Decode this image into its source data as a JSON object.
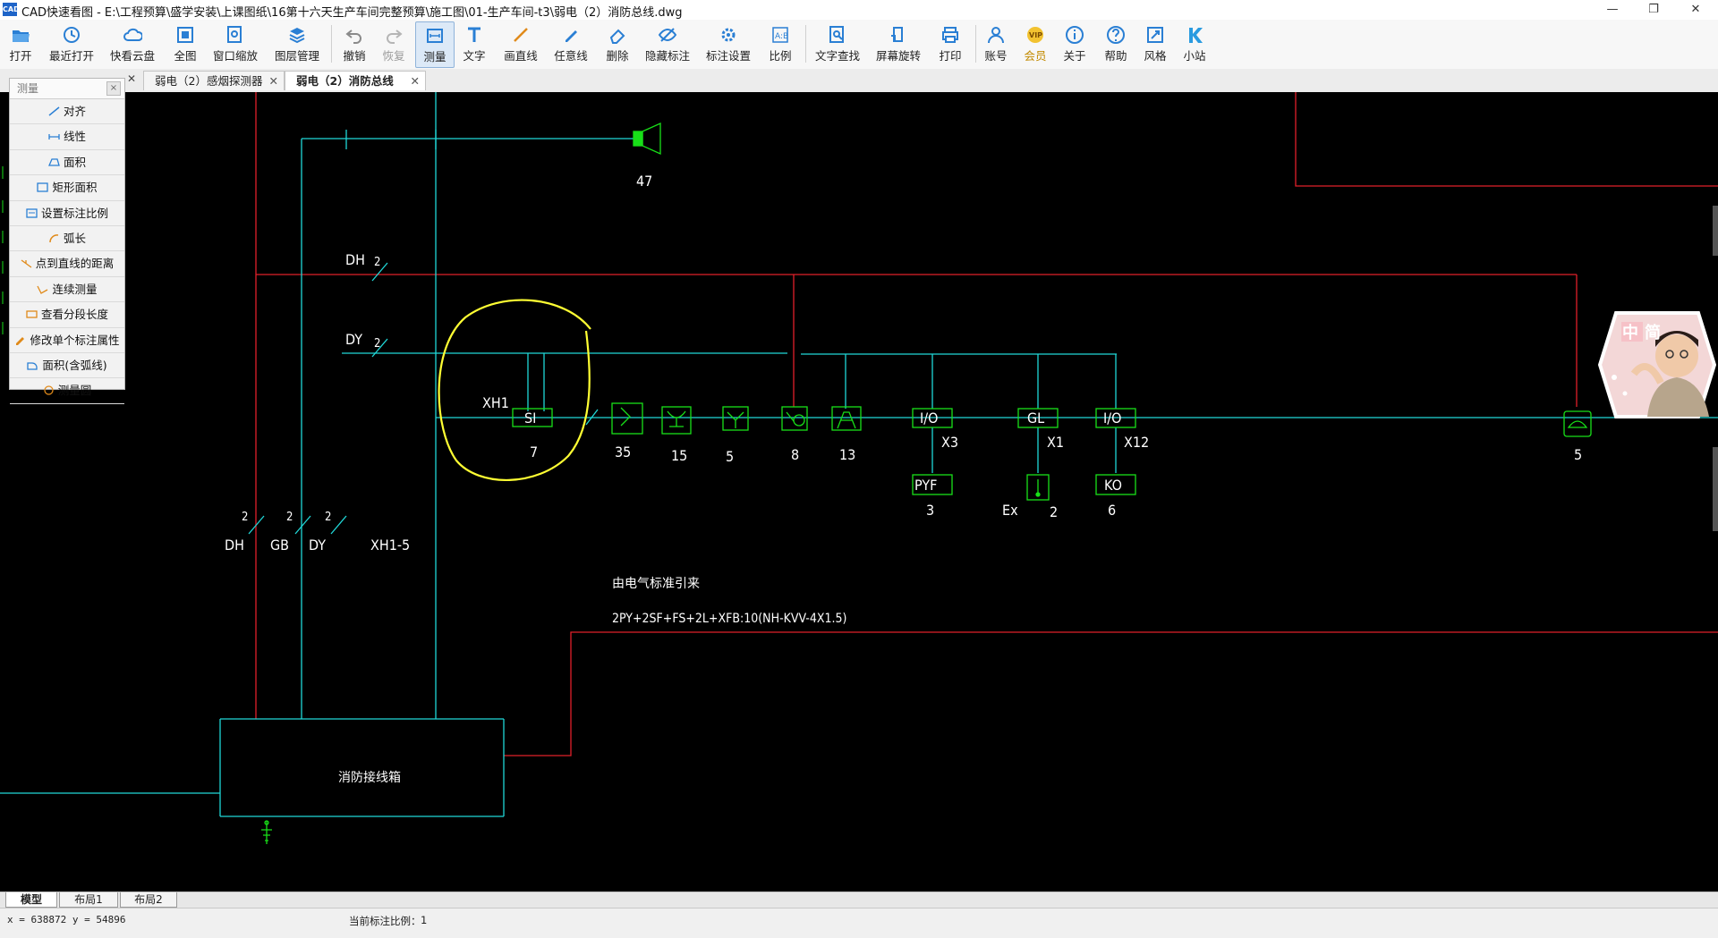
{
  "window": {
    "title": "CAD快速看图 - E:\\工程预算\\盛学安装\\上课图纸\\16第十六天生产车间完整预算\\施工图\\01-生产车间-t3\\弱电（2）消防总线.dwg",
    "app_icon": "CAD",
    "controls": {
      "minimize": "—",
      "maximize": "❐",
      "close": "✕"
    }
  },
  "toolbar": {
    "buttons": [
      {
        "label": "打开",
        "icon": "folder-open-icon"
      },
      {
        "label": "最近打开",
        "icon": "history-icon"
      },
      {
        "label": "快看云盘",
        "icon": "cloud-icon"
      },
      {
        "label": "全图",
        "icon": "fullview-icon"
      },
      {
        "label": "窗口缩放",
        "icon": "window-zoom-icon"
      },
      {
        "label": "图层管理",
        "icon": "layers-icon"
      },
      {
        "label": "撤销",
        "icon": "undo-icon"
      },
      {
        "label": "恢复",
        "icon": "redo-icon"
      },
      {
        "label": "测量",
        "icon": "measure-icon"
      },
      {
        "label": "文字",
        "icon": "text-icon"
      },
      {
        "label": "画直线",
        "icon": "line-icon"
      },
      {
        "label": "任意线",
        "icon": "pen-icon"
      },
      {
        "label": "删除",
        "icon": "eraser-icon"
      },
      {
        "label": "隐藏标注",
        "icon": "hide-icon"
      },
      {
        "label": "标注设置",
        "icon": "settings-icon"
      },
      {
        "label": "比例",
        "icon": "scale-icon"
      },
      {
        "label": "文字查找",
        "icon": "text-search-icon"
      },
      {
        "label": "屏幕旋转",
        "icon": "rotate-icon"
      },
      {
        "label": "打印",
        "icon": "printer-icon"
      },
      {
        "label": "账号",
        "icon": "user-icon"
      },
      {
        "label": "会员",
        "icon": "vip-icon"
      },
      {
        "label": "关于",
        "icon": "info-icon"
      },
      {
        "label": "帮助",
        "icon": "help-icon"
      },
      {
        "label": "风格",
        "icon": "style-icon"
      },
      {
        "label": "小站",
        "icon": "station-icon"
      }
    ],
    "active": "测量"
  },
  "tabs": {
    "items": [
      {
        "label": "弱电（2）感烟探测器",
        "close": "✕"
      },
      {
        "label": "弱电（2）消防总线",
        "close": "✕"
      }
    ],
    "hidden_tab_close": "✕"
  },
  "measure_panel": {
    "title": "测量",
    "close": "×",
    "items": [
      "对齐",
      "线性",
      "面积",
      "矩形面积",
      "设置标注比例",
      "弧长",
      "点到直线的距离",
      "连续测量",
      "查看分段长度",
      "修改单个标注属性",
      "面积(含弧线)",
      "测量圆"
    ]
  },
  "drawing": {
    "labels": {
      "dh_top": "DH",
      "dy_top": "DY",
      "slash_count_top": "2",
      "slash_count_dy": "2",
      "speaker_count": "47",
      "xh1": "XH1",
      "si": "SI",
      "si_count": "7",
      "d35": "35",
      "d15": "15",
      "d5a": "5",
      "d8": "8",
      "d13": "13",
      "io1": "I/O",
      "x3": "X3",
      "gl": "GL",
      "x1": "X1",
      "io2": "I/O",
      "x12": "X12",
      "pyf": "PYF",
      "pyf_count": "3",
      "ex": "Ex",
      "ex_count": "2",
      "ko": "KO",
      "ko_count": "6",
      "phone_count": "5",
      "bottom_dh": "DH",
      "bottom_gb": "GB",
      "bottom_dy": "DY",
      "bottom_xh": "XH1-5",
      "bottom_n1": "2",
      "bottom_n2": "2",
      "bottom_n3": "2",
      "note_title": "由电气标准引来",
      "note_cable": "2PY+2SF+FS+2L+XFB:10(NH-KVV-4X1.5)",
      "panel": "消防接线箱"
    },
    "colors": {
      "background": "#000000",
      "red": "#e0202a",
      "cyan": "#20d8d8",
      "green": "#18e018",
      "white": "#ffffff",
      "yellow": "#ffff33"
    }
  },
  "avatar": {
    "chars": [
      "中",
      "简"
    ]
  },
  "layout_tabs": [
    "模型",
    "布局1",
    "布局2"
  ],
  "status": {
    "coords": "x = 638872  y = 54896",
    "scale_label": "当前标注比例：",
    "scale_value": "1"
  }
}
